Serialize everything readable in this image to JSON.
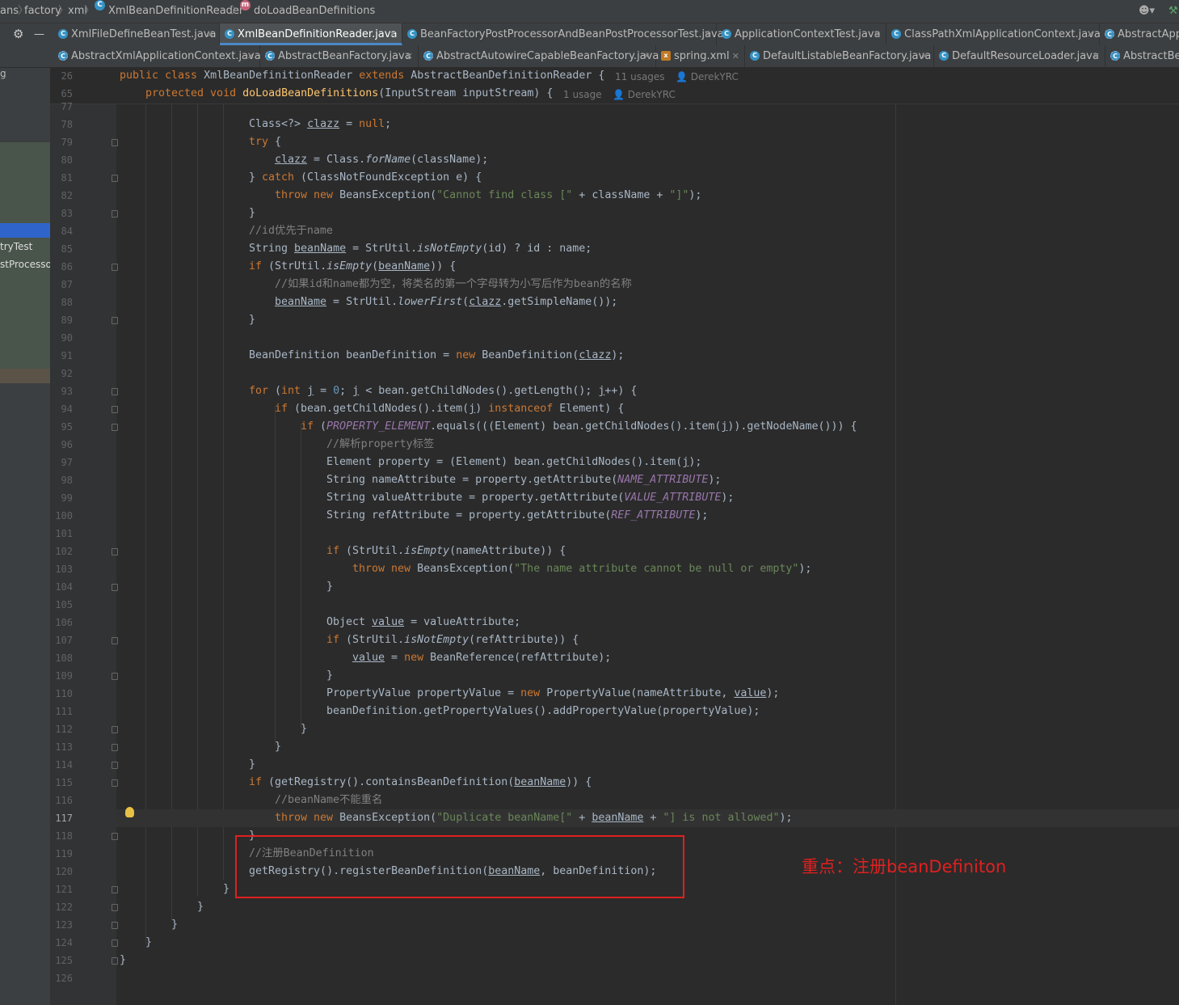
{
  "breadcrumb": [
    "ans",
    "factory",
    "xml",
    "XmlBeanDefinitionReader",
    "doLoadBeanDefinitions"
  ],
  "tabs_row1": [
    {
      "label": "XmlFileDefineBeanTest.java",
      "icon": "class-icon",
      "active": false
    },
    {
      "label": "XmlBeanDefinitionReader.java",
      "icon": "class-icon",
      "active": true
    },
    {
      "label": "BeanFactoryPostProcessorAndBeanPostProcessorTest.java",
      "icon": "class-icon",
      "active": false
    },
    {
      "label": "ApplicationContextTest.java",
      "icon": "class-icon",
      "active": false
    },
    {
      "label": "ClassPathXmlApplicationContext.java",
      "icon": "class-icon",
      "active": false
    },
    {
      "label": "AbstractApp",
      "icon": "abstract-class-icon",
      "active": false
    }
  ],
  "tabs_row2": [
    {
      "label": "AbstractXmlApplicationContext.java",
      "icon": "abstract-class-icon"
    },
    {
      "label": "AbstractBeanFactory.java",
      "icon": "abstract-class-icon"
    },
    {
      "label": "AbstractAutowireCapableBeanFactory.java",
      "icon": "abstract-class-icon"
    },
    {
      "label": "spring.xml",
      "icon": "xml-file-icon"
    },
    {
      "label": "DefaultListableBeanFactory.java",
      "icon": "class-icon"
    },
    {
      "label": "DefaultResourceLoader.java",
      "icon": "class-icon"
    },
    {
      "label": "AbstractBe",
      "icon": "abstract-class-icon"
    }
  ],
  "left_panel": [
    "g",
    "tryTest",
    "stProcesso"
  ],
  "sticky": {
    "line1_num": "26",
    "line1_code": "public class XmlBeanDefinitionReader extends AbstractBeanDefinitionReader {",
    "line1_usages": "11 usages",
    "line1_author": "DerekYRC",
    "line2_num": "65",
    "line2_code": "protected void doLoadBeanDefinitions(InputStream inputStream) {",
    "line2_usages": "1 usage",
    "line2_author": "DerekYRC"
  },
  "code_lines": [
    {
      "n": "77",
      "t": ""
    },
    {
      "n": "78",
      "t": "Class<?> clazz = null;"
    },
    {
      "n": "79",
      "t": "try {"
    },
    {
      "n": "80",
      "t": "clazz = Class.forName(className);"
    },
    {
      "n": "81",
      "t": "} catch (ClassNotFoundException e) {"
    },
    {
      "n": "82",
      "t": "throw new BeansException(\"Cannot find class [\" + className + \"]\");"
    },
    {
      "n": "83",
      "t": "}"
    },
    {
      "n": "84",
      "t": "//id优先于name"
    },
    {
      "n": "85",
      "t": "String beanName = StrUtil.isNotEmpty(id) ? id : name;"
    },
    {
      "n": "86",
      "t": "if (StrUtil.isEmpty(beanName)) {"
    },
    {
      "n": "87",
      "t": "//如果id和name都为空，将类名的第一个字母转为小写后作为bean的名称"
    },
    {
      "n": "88",
      "t": "beanName = StrUtil.lowerFirst(clazz.getSimpleName());"
    },
    {
      "n": "89",
      "t": "}"
    },
    {
      "n": "90",
      "t": ""
    },
    {
      "n": "91",
      "t": "BeanDefinition beanDefinition = new BeanDefinition(clazz);"
    },
    {
      "n": "92",
      "t": ""
    },
    {
      "n": "93",
      "t": "for (int j = 0; j < bean.getChildNodes().getLength(); j++) {"
    },
    {
      "n": "94",
      "t": "if (bean.getChildNodes().item(j) instanceof Element) {"
    },
    {
      "n": "95",
      "t": "if (PROPERTY_ELEMENT.equals(((Element) bean.getChildNodes().item(j)).getNodeName())) {"
    },
    {
      "n": "96",
      "t": "//解析property标签"
    },
    {
      "n": "97",
      "t": "Element property = (Element) bean.getChildNodes().item(j);"
    },
    {
      "n": "98",
      "t": "String nameAttribute = property.getAttribute(NAME_ATTRIBUTE);"
    },
    {
      "n": "99",
      "t": "String valueAttribute = property.getAttribute(VALUE_ATTRIBUTE);"
    },
    {
      "n": "100",
      "t": "String refAttribute = property.getAttribute(REF_ATTRIBUTE);"
    },
    {
      "n": "101",
      "t": ""
    },
    {
      "n": "102",
      "t": "if (StrUtil.isEmpty(nameAttribute)) {"
    },
    {
      "n": "103",
      "t": "throw new BeansException(\"The name attribute cannot be null or empty\");"
    },
    {
      "n": "104",
      "t": "}"
    },
    {
      "n": "105",
      "t": ""
    },
    {
      "n": "106",
      "t": "Object value = valueAttribute;"
    },
    {
      "n": "107",
      "t": "if (StrUtil.isNotEmpty(refAttribute)) {"
    },
    {
      "n": "108",
      "t": "value = new BeanReference(refAttribute);"
    },
    {
      "n": "109",
      "t": "}"
    },
    {
      "n": "110",
      "t": "PropertyValue propertyValue = new PropertyValue(nameAttribute, value);"
    },
    {
      "n": "111",
      "t": "beanDefinition.getPropertyValues().addPropertyValue(propertyValue);"
    },
    {
      "n": "112",
      "t": "}"
    },
    {
      "n": "113",
      "t": "}"
    },
    {
      "n": "114",
      "t": "}"
    },
    {
      "n": "115",
      "t": "if (getRegistry().containsBeanDefinition(beanName)) {"
    },
    {
      "n": "116",
      "t": "//beanName不能重名"
    },
    {
      "n": "117",
      "t": "throw new BeansException(\"Duplicate beanName[\" + beanName + \"] is not allowed\");"
    },
    {
      "n": "118",
      "t": "}"
    },
    {
      "n": "119",
      "t": "//注册BeanDefinition"
    },
    {
      "n": "120",
      "t": "getRegistry().registerBeanDefinition(beanName, beanDefinition);"
    },
    {
      "n": "121",
      "t": "}"
    },
    {
      "n": "122",
      "t": "}"
    },
    {
      "n": "123",
      "t": "}"
    },
    {
      "n": "124",
      "t": "}"
    },
    {
      "n": "125",
      "t": "}"
    },
    {
      "n": "126",
      "t": ""
    }
  ],
  "annotation": {
    "text": "重点：注册beanDefiniton",
    "color": "#e02020"
  },
  "colors": {
    "keyword": "#cc7832",
    "string": "#6a8759",
    "comment": "#808080",
    "method_decl": "#ffc66d",
    "constant": "#9876aa",
    "number": "#6897bb"
  }
}
